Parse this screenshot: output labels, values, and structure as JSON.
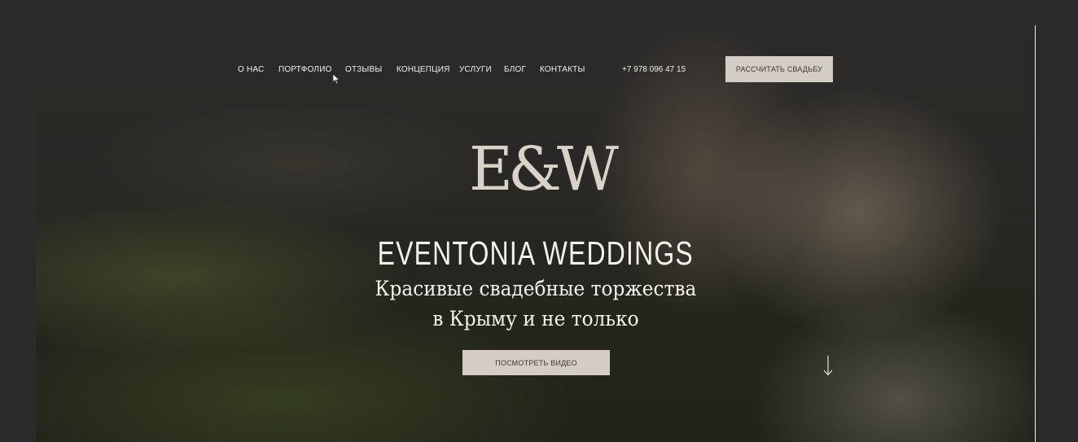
{
  "nav": {
    "items": [
      {
        "label": "О НАС"
      },
      {
        "label": "ПОРТФОЛИО"
      },
      {
        "label": "ОТЗЫВЫ"
      },
      {
        "label": "КОНЦЕПЦИЯ"
      },
      {
        "label": "УСЛУГИ"
      },
      {
        "label": "БЛОГ"
      },
      {
        "label": "КОНТАКТЫ"
      }
    ],
    "phone": "+7 978 096 47 15",
    "cta_label": "РАССЧИТАТЬ СВАДЬБУ"
  },
  "hero": {
    "logo_text": "E&W",
    "brand": "EVENTONIA WEDDINGS",
    "tagline_line1": "Красивые свадебные торжества",
    "tagline_line2": "в Крыму и не только",
    "video_button_label": "ПОСМОТРЕТЬ ВИДЕО",
    "scroll_icon": "arrow-down-icon"
  },
  "colors": {
    "button_bg": "#d4cdc5",
    "button_text": "#3b3835",
    "text_light": "#f4f1ec",
    "background": "#2b2b2b"
  }
}
